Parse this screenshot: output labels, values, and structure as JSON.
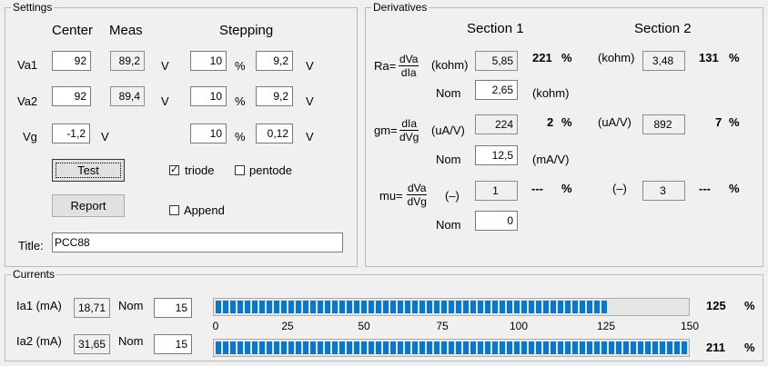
{
  "settings": {
    "title": "Settings",
    "col_center": "Center",
    "col_meas": "Meas",
    "col_stepping": "Stepping",
    "rows": [
      {
        "label": "Va1",
        "center": "92",
        "meas": "89,2",
        "unit": "V",
        "step_pct": "10",
        "pct": "%",
        "step_val": "9,2",
        "step_unit": "V"
      },
      {
        "label": "Va2",
        "center": "92",
        "meas": "89,4",
        "unit": "V",
        "step_pct": "10",
        "pct": "%",
        "step_val": "9,2",
        "step_unit": "V"
      },
      {
        "label": "Vg",
        "center": "-1,2",
        "unit": "V",
        "step_pct": "10",
        "pct": "%",
        "step_val": "0,12",
        "step_unit": "V"
      }
    ],
    "test_button": "Test",
    "report_button": "Report",
    "triode_label": "triode",
    "triode_checked": true,
    "pentode_label": "pentode",
    "pentode_checked": false,
    "append_label": "Append",
    "append_checked": false,
    "title_label": "Title:",
    "title_value": "PCC88"
  },
  "derivatives": {
    "title": "Derivatives",
    "section1": "Section 1",
    "section2": "Section 2",
    "ra": {
      "label": "Ra=",
      "num": "dVa",
      "den": "dIa",
      "unit1": "(kohm)",
      "val1": "5,85",
      "pct1": "221",
      "pct1_sign": "%",
      "unit2": "(kohm)",
      "val2": "3,48",
      "pct2": "131",
      "pct2_sign": "%",
      "nom_label": "Nom",
      "nom": "2,65",
      "nom_unit": "(kohm)"
    },
    "gm": {
      "label": "gm=",
      "num": "dIa",
      "den": "dVg",
      "unit1": "(uA/V)",
      "val1": "224",
      "pct1": "2",
      "pct1_sign": "%",
      "unit2": "(uA/V)",
      "val2": "892",
      "pct2": "7",
      "pct2_sign": "%",
      "nom_label": "Nom",
      "nom": "12,5",
      "nom_unit": "(mA/V)"
    },
    "mu": {
      "label": "mu=",
      "num": "dVa",
      "den": "dVg",
      "unit1": "(–)",
      "val1": "1",
      "pct1": "---",
      "pct1_sign": "%",
      "unit2": "(–)",
      "val2": "3",
      "pct2": "---",
      "pct2_sign": "%",
      "nom_label": "Nom",
      "nom": "0"
    }
  },
  "currents": {
    "title": "Currents",
    "ia1": {
      "label": "Ia1 (mA)",
      "value": "18,71",
      "nom_label": "Nom",
      "nom": "15",
      "pct": "125",
      "pct_sign": "%",
      "level_pct": 125
    },
    "ia2": {
      "label": "Ia2 (mA)",
      "value": "31,65",
      "nom_label": "Nom",
      "nom": "15",
      "pct": "211",
      "pct_sign": "%",
      "level_pct": 150
    },
    "scale_max": 150,
    "ticks": [
      "0",
      "25",
      "50",
      "75",
      "100",
      "125",
      "150"
    ]
  }
}
